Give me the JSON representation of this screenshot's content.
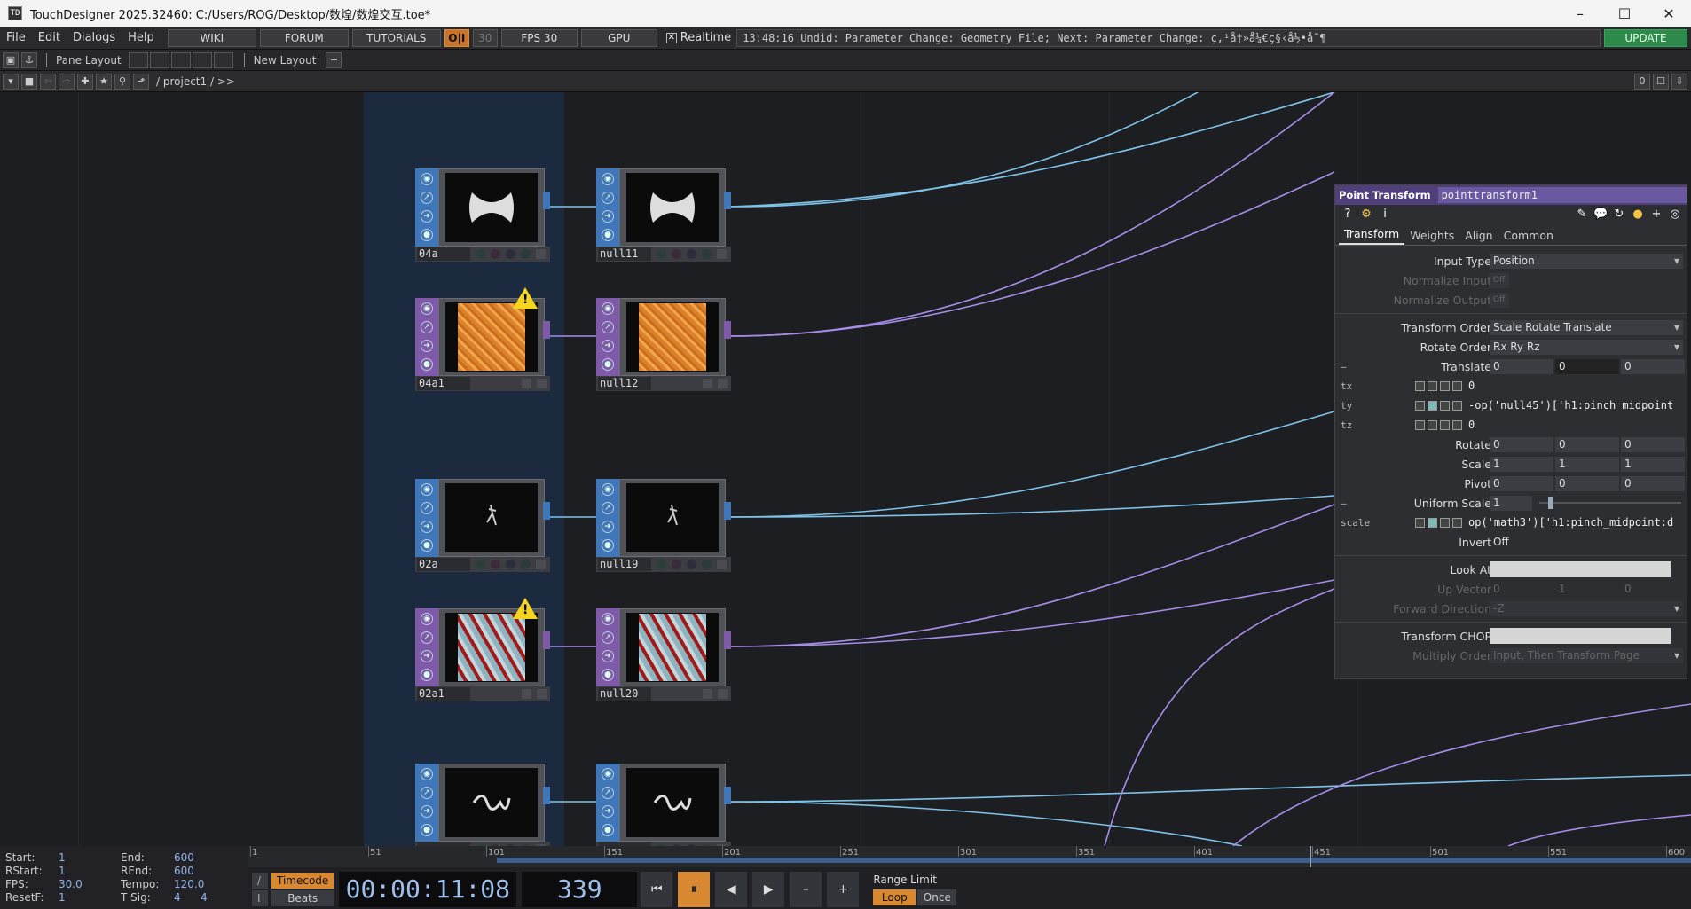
{
  "window": {
    "title": "TouchDesigner 2025.32460: C:/Users/ROG/Desktop/数煌/数煌交互.toe*",
    "app_icon": "TD",
    "minimize": "–",
    "maximize": "☐",
    "close": "✕"
  },
  "menu": {
    "items": [
      "File",
      "Edit",
      "Dialogs",
      "Help"
    ],
    "wiki": "WIKI",
    "forum": "FORUM",
    "tutorials": "TUTORIALS",
    "oi": "O|I",
    "thirty": "30",
    "fps": "FPS  30",
    "gpu": "GPU",
    "realtime_check": "✕",
    "realtime": "Realtime",
    "status": "13:48:16 Undid: Parameter Change: Geometry File; Next: Parameter Change: ç,¹å†»å¼€ç§‹å½•å˜¶",
    "update": "UPDATE"
  },
  "panebar": {
    "pane_layout": "Pane Layout",
    "new_layout": "New Layout",
    "plus": "+"
  },
  "pathbar": {
    "path": "/ project1 / >>",
    "zero": "0"
  },
  "nodes": [
    {
      "name": "04a",
      "color": "#3f77b8",
      "thumb": "bowtie",
      "warn": false
    },
    {
      "name": "null11",
      "color": "#3f77b8",
      "thumb": "bowtie",
      "warn": false
    },
    {
      "name": "04a1",
      "color": "#7f5aa8",
      "thumb": "orange-texture",
      "warn": true
    },
    {
      "name": "null12",
      "color": "#7f5aa8",
      "thumb": "orange-texture",
      "warn": false
    },
    {
      "name": "02a",
      "color": "#3f77b8",
      "thumb": "figure",
      "warn": false
    },
    {
      "name": "null19",
      "color": "#3f77b8",
      "thumb": "figure",
      "warn": false
    },
    {
      "name": "02a1",
      "color": "#7f5aa8",
      "thumb": "red-texture",
      "warn": true
    },
    {
      "name": "null20",
      "color": "#7f5aa8",
      "thumb": "red-texture",
      "warn": false
    },
    {
      "name": "",
      "color": "#3f77b8",
      "thumb": "squiggle",
      "warn": false
    },
    {
      "name": "",
      "color": "#3f77b8",
      "thumb": "squiggle",
      "warn": false
    }
  ],
  "params": {
    "op_type": "Point Transform",
    "op_name": "pointtransform1",
    "tabs": [
      "Transform",
      "Weights",
      "Align",
      "Common"
    ],
    "input_type_label": "Input Type",
    "input_type": "Position",
    "normalize_input_label": "Normalize Input",
    "normalize_output_label": "Normalize Output",
    "off_small": "Off",
    "transform_order_label": "Transform Order",
    "transform_order": "Scale Rotate Translate",
    "rotate_order_label": "Rotate Order",
    "rotate_order": "Rx Ry Rz",
    "translate_label": "Translate",
    "translate": [
      "0",
      "0",
      "0"
    ],
    "tx_label": "tx",
    "tx": "0",
    "ty_label": "ty",
    "ty": "-op('null45')['h1:pinch_midpoint",
    "tz_label": "tz",
    "tz": "0",
    "rotate_label": "Rotate",
    "rotate": [
      "0",
      "0",
      "0"
    ],
    "scale_label": "Scale",
    "scale": [
      "1",
      "1",
      "1"
    ],
    "pivot_label": "Pivot",
    "pivot": [
      "0",
      "0",
      "0"
    ],
    "uniform_scale_label": "Uniform Scale",
    "uniform_scale": "1",
    "scale_sub_label": "scale",
    "scale_expr": "op('math3')['h1:pinch_midpoint:d",
    "invert_label": "Invert",
    "invert": "Off",
    "look_at_label": "Look At",
    "up_vector_label": "Up Vector",
    "up_vector": [
      "0",
      "1",
      "0"
    ],
    "forward_label": "Forward Direction",
    "forward": "-Z",
    "transform_chop_label": "Transform CHOP",
    "multiply_order_label": "Multiply Order",
    "multiply_order": "Input, Then Transform Page",
    "collapse": "—"
  },
  "timeline": {
    "start_label": "Start:",
    "start": "1",
    "end_label": "End:",
    "end": "600",
    "rstart_label": "RStart:",
    "rstart": "1",
    "rend_label": "REnd:",
    "rend": "600",
    "fps_label": "FPS:",
    "fps": "30.0",
    "tempo_label": "Tempo:",
    "tempo": "120.0",
    "resetf_label": "ResetF:",
    "resetf": "1",
    "tsig_label": "T Sig:",
    "tsig": [
      "4",
      "4"
    ],
    "ticks": [
      "1",
      "51",
      "101",
      "151",
      "201",
      "251",
      "301",
      "351",
      "401",
      "451",
      "501",
      "551",
      "600"
    ],
    "timecode_btn": "Timecode",
    "beats_btn": "Beats",
    "timecode": "00:00:11:08",
    "frame": "339",
    "range_limit": "Range Limit",
    "loop": "Loop",
    "once": "Once",
    "slash": "/",
    "i": "I"
  },
  "colors": {
    "blue_wire": "#7fc3e8",
    "purple_wire": "#a68de8",
    "accent": "#d98832"
  }
}
